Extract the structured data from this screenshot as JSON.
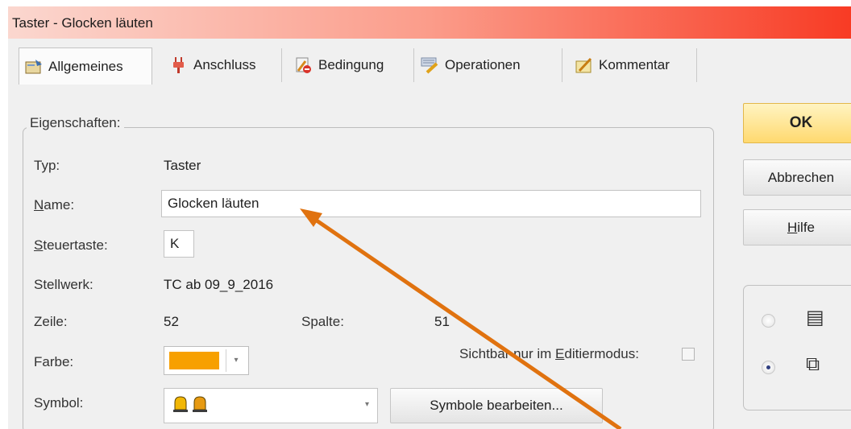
{
  "window": {
    "title": "Taster - Glocken läuten"
  },
  "tabs": [
    {
      "label": "Allgemeines",
      "icon": "general-icon"
    },
    {
      "label": "Anschluss",
      "icon": "plug-icon"
    },
    {
      "label": "Bedingung",
      "icon": "condition-icon"
    },
    {
      "label": "Operationen",
      "icon": "operations-icon"
    },
    {
      "label": "Kommentar",
      "icon": "comment-icon"
    }
  ],
  "properties": {
    "legend": "Eigenschaften:",
    "typ_label": "Typ:",
    "typ_value": "Taster",
    "name_label_a": "N",
    "name_label_b": "ame:",
    "name_value": "Glocken läuten",
    "steuertaste_label_a": "S",
    "steuertaste_label_b": "teuertaste:",
    "steuertaste_value": "K",
    "stellwerk_label": "Stellwerk:",
    "stellwerk_value": "TC ab 09_9_2016",
    "zeile_label": "Zeile:",
    "zeile_value": "52",
    "spalte_label": "Spalte:",
    "spalte_value": "51",
    "farbe_label": "Farbe:",
    "farbe_color": "#f7a000",
    "sichtbar_label_a": "Sichtbar nur im ",
    "sichtbar_label_b": "E",
    "sichtbar_label_c": "ditiermodus:",
    "symbol_label": "Symbol:",
    "symbol_icons": [
      "bell-icon",
      "bell-icon"
    ],
    "symbol_button": "Symbole bearbeiten..."
  },
  "buttons": {
    "ok": "OK",
    "abbrechen": "Abbrechen",
    "hilfe_a": "H",
    "hilfe_b": "ilfe"
  },
  "colors": {
    "annotation_arrow": "#e0720f",
    "ok_button": "#ffd96f"
  }
}
